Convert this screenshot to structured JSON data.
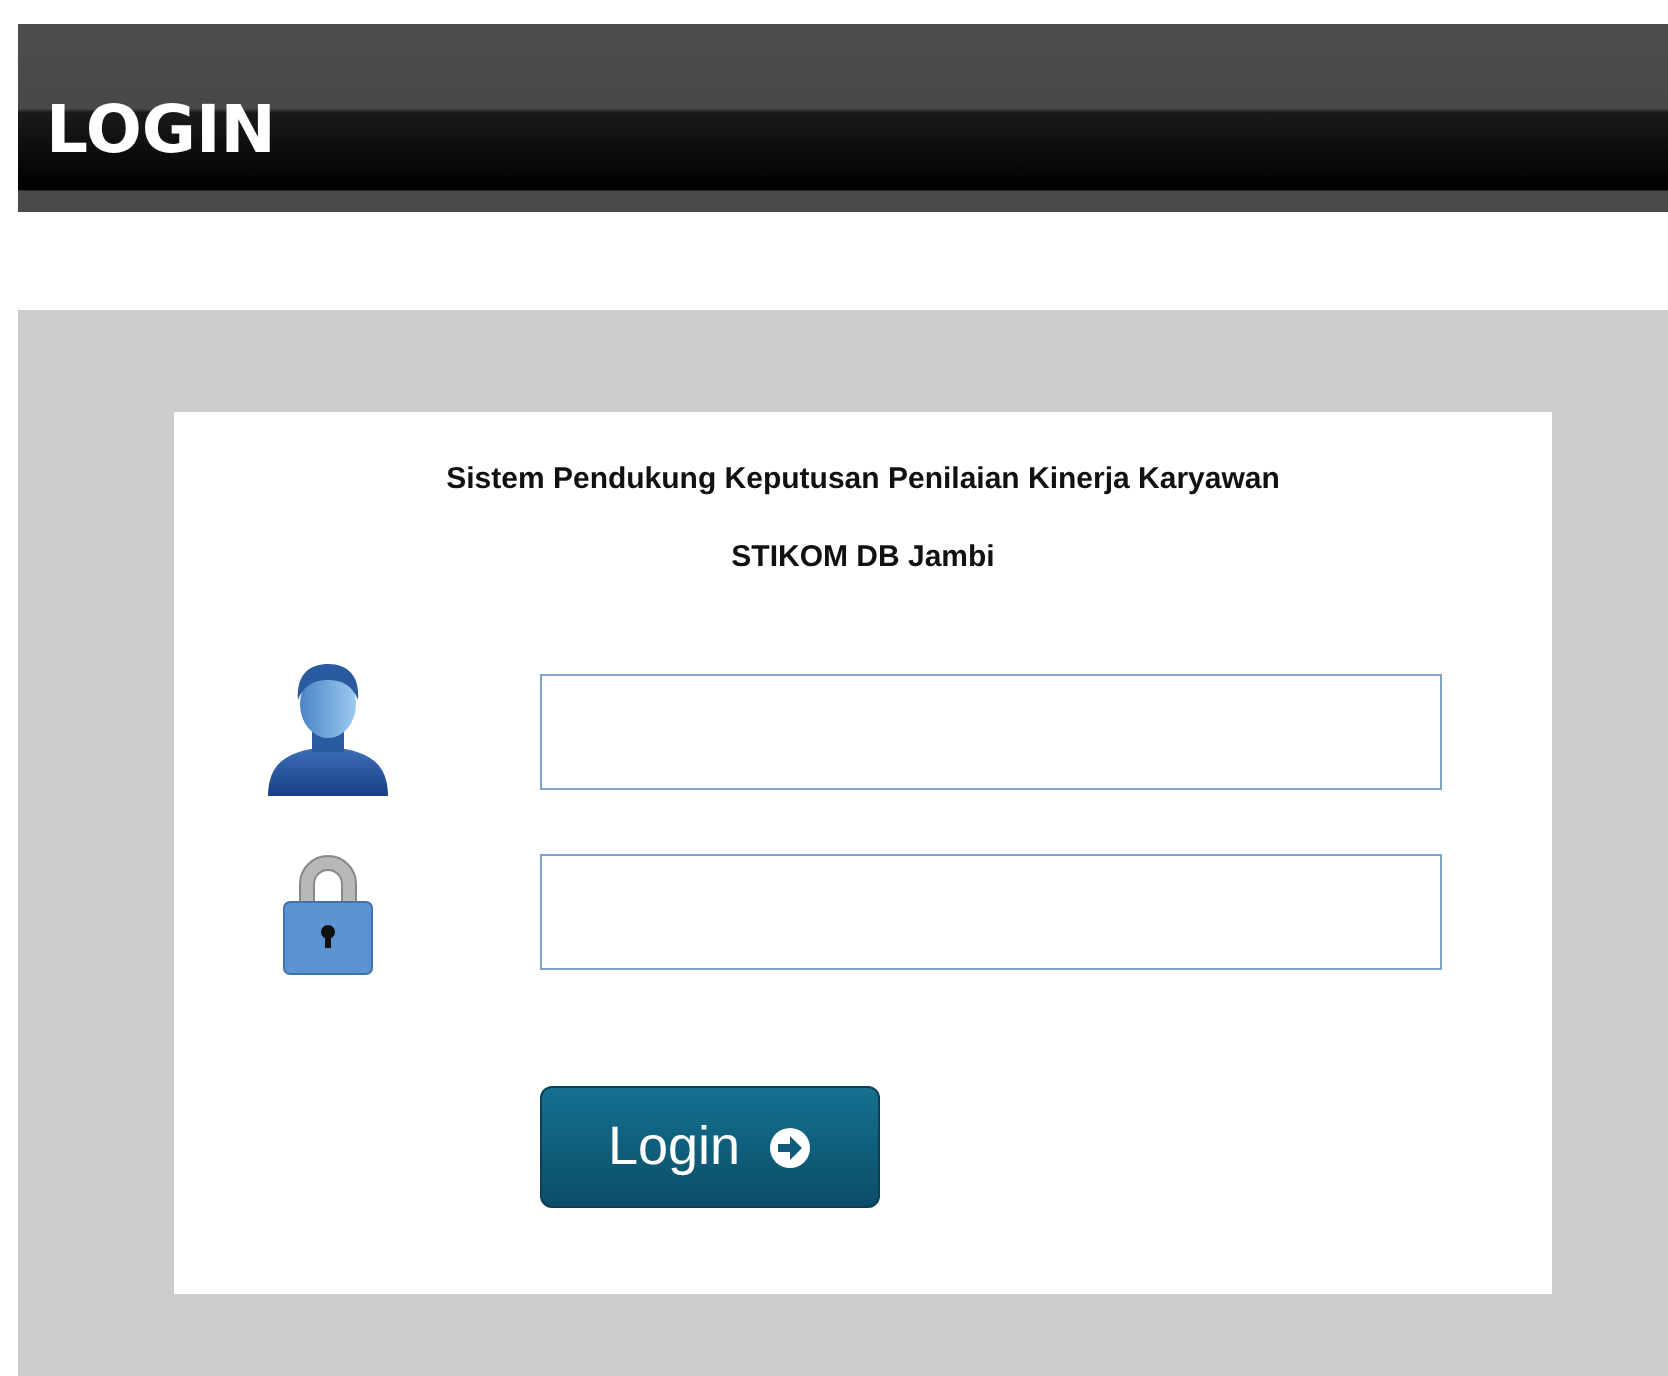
{
  "header": {
    "title": "LOGIN"
  },
  "form": {
    "title_lines": [
      "Sistem Pendukung Keputusan Penilaian Kinerja Karyawan",
      "STIKOM DB Jambi"
    ],
    "fields": [
      {
        "kind": "user"
      },
      {
        "kind": "lock"
      }
    ],
    "button": {
      "label": "Login"
    }
  }
}
